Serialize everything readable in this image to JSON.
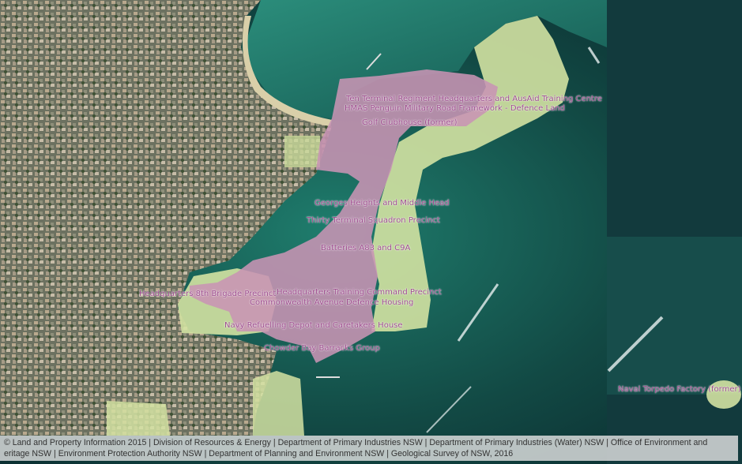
{
  "map": {
    "colors": {
      "precinct_fill": "#c894b4",
      "green_fill": "#d3e2a2",
      "label": "#9c4a8c",
      "sea_deep": "#0c3033",
      "sea_shallow": "#1f7a6a",
      "urban": "#6f7560"
    },
    "labels": [
      {
        "id": "ten-terminal",
        "text": "Ten Terminal Regiment Headquarters and AusAid Training Centre"
      },
      {
        "id": "hmas-penguin",
        "text": "HMAS Penguin"
      },
      {
        "id": "military-road",
        "text": "Military Road Framework - Defence Land"
      },
      {
        "id": "golf-clubhouse",
        "text": "Golf Clubhouse (former)"
      },
      {
        "id": "georges-heights",
        "text": "Georges Heights and Middle Head"
      },
      {
        "id": "thirty-terminal",
        "text": "Thirty Terminal Squadron Precinct"
      },
      {
        "id": "batteries",
        "text": "Batteries A83 and C9A"
      },
      {
        "id": "hq-8th-brigade",
        "text": "Headquarters 8th Brigade Precinct"
      },
      {
        "id": "hq-training",
        "text": "Headquarters Training Command Precinct"
      },
      {
        "id": "commonwealth-ave",
        "text": "Commonwealth Avenue Defence Housing"
      },
      {
        "id": "navy-refuelling",
        "text": "Navy Refuelling Depot and Caretakers House"
      },
      {
        "id": "chowder-bay",
        "text": "Chowder Bay Barracks Group"
      },
      {
        "id": "naval-torpedo",
        "text": "Naval Torpedo Factory (former)"
      }
    ]
  },
  "attribution": {
    "line1": "© Land and Property Information 2015 | Division of Resources & Energy | Department of Primary Industries NSW | Department of Primary Industries (Water) NSW | Office of Environment and",
    "line2": "eritage NSW | Environment Protection Authority NSW | Department of Planning and Environment NSW | Geological Survey of NSW, 2016"
  }
}
